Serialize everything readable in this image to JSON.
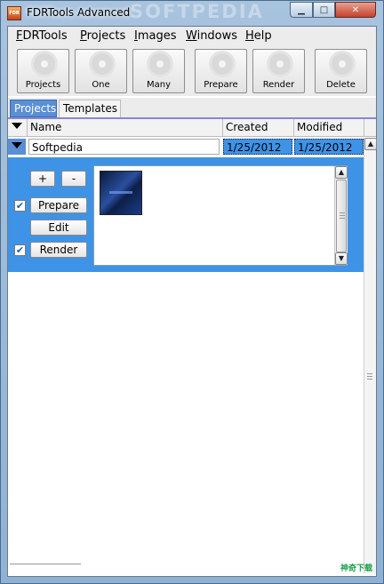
{
  "window": {
    "title": "FDRTools Advanced",
    "app_icon_label": "FDR",
    "watermark": "SOFTPEDIA"
  },
  "menubar": {
    "items": [
      {
        "label": "FDRTools",
        "accel": "F",
        "rest": "DRTools"
      },
      {
        "label": "Projects",
        "accel": "P",
        "rest": "rojects"
      },
      {
        "label": "Images",
        "accel": "I",
        "rest": "mages"
      },
      {
        "label": "Windows",
        "accel": "W",
        "rest": "indows"
      },
      {
        "label": "Help",
        "accel": "H",
        "rest": "elp"
      }
    ]
  },
  "toolbar": {
    "buttons": [
      {
        "label": "Projects",
        "icon": "projects-icon"
      },
      {
        "label": "One",
        "icon": "gear-icon"
      },
      {
        "label": "Many",
        "icon": "gears-icon"
      },
      {
        "label": "Prepare",
        "icon": "prepare-icon"
      },
      {
        "label": "Render",
        "icon": "render-icon"
      },
      {
        "label": "Delete",
        "icon": "delete-icon"
      }
    ]
  },
  "tabs": [
    {
      "label": "Projects",
      "active": true
    },
    {
      "label": "Templates",
      "active": false
    }
  ],
  "table": {
    "columns": [
      "Name",
      "Created",
      "Modified"
    ],
    "rows": [
      {
        "name": "Softpedia",
        "created": "1/25/2012",
        "modified": "1/25/2012"
      }
    ]
  },
  "detail": {
    "plus_label": "+",
    "minus_label": "-",
    "prepare_label": "Prepare",
    "prepare_checked": true,
    "edit_label": "Edit",
    "render_label": "Render",
    "render_checked": true,
    "check_glyph": "✔",
    "thumbnail": "project-thumbnail"
  },
  "scroll": {
    "up_glyph": "▲",
    "down_glyph": "▼"
  },
  "branding": {
    "text": "神奇下载"
  },
  "colors": {
    "selection": "#3e93e6",
    "tab_active": "#5a8fd6",
    "window_frame": "#8fb1d4"
  }
}
